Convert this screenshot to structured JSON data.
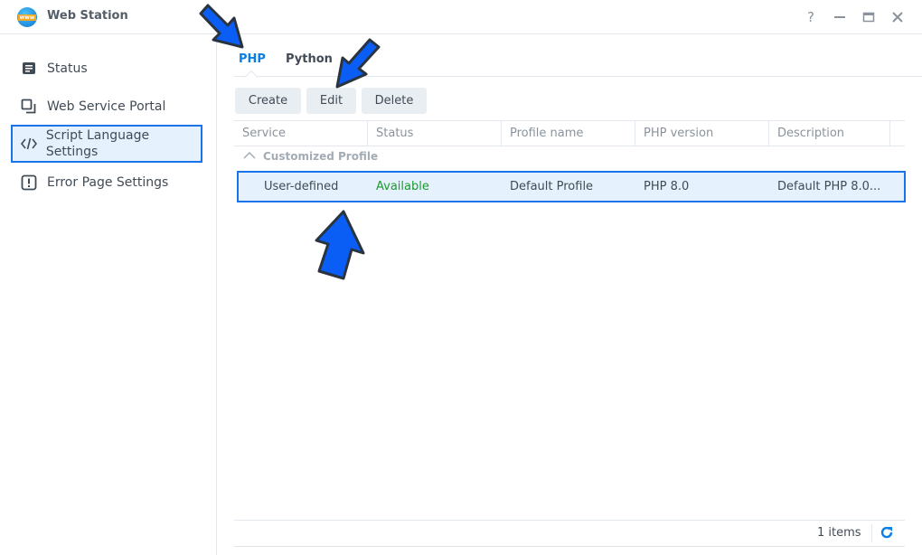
{
  "window": {
    "title": "Web Station",
    "app_icon": "web-station-icon",
    "controls": {
      "help": "?",
      "minimize": "—",
      "maximize": "▭",
      "close": "✕"
    }
  },
  "sidebar": {
    "items": [
      {
        "label": "Status",
        "icon": "status-icon",
        "selected": false
      },
      {
        "label": "Web Service Portal",
        "icon": "portal-icon",
        "selected": false
      },
      {
        "label": "Script Language Settings",
        "icon": "code-icon",
        "selected": true
      },
      {
        "label": "Error Page Settings",
        "icon": "error-page-icon",
        "selected": false
      }
    ]
  },
  "tabs": [
    {
      "label": "PHP",
      "active": true
    },
    {
      "label": "Python",
      "active": false
    }
  ],
  "toolbar": {
    "create_label": "Create",
    "edit_label": "Edit",
    "delete_label": "Delete"
  },
  "table": {
    "columns": [
      "Service",
      "Status",
      "Profile name",
      "PHP version",
      "Description"
    ],
    "group_label": "Customized Profile",
    "rows": [
      {
        "service": "User-defined",
        "status": "Available",
        "profile_name": "Default Profile",
        "php_version": "PHP 8.0",
        "description": "Default PHP 8.0..."
      }
    ]
  },
  "footer": {
    "count": "1 items"
  },
  "colors": {
    "accent": "#0c7ee6",
    "available": "#1a9c2d",
    "selection_bg": "#e5f1fc",
    "annotation_arrow": "#0a5ef5"
  }
}
